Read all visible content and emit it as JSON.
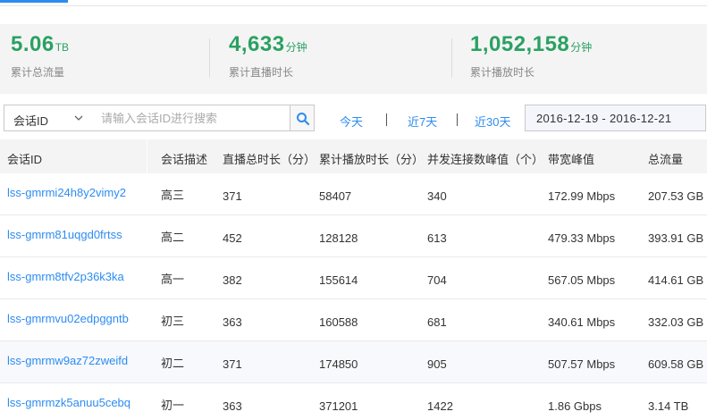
{
  "stats": [
    {
      "value": "5.06",
      "unit": "TB",
      "label": "累计总流量"
    },
    {
      "value": "4,633",
      "unit": "分钟",
      "label": "累计直播时长"
    },
    {
      "value": "1,052,158",
      "unit": "分钟",
      "label": "累计播放时长"
    }
  ],
  "filter": {
    "select_value": "会话ID",
    "search_placeholder": "请输入会话ID进行搜索",
    "quick_ranges": [
      "今天",
      "近7天",
      "近30天"
    ],
    "date_range": "2016-12-19 - 2016-12-21"
  },
  "table": {
    "headers": [
      "会话ID",
      "会话描述",
      "直播总时长（分）",
      "累计播放时长（分）",
      "并发连接数峰值（个）",
      "带宽峰值",
      "总流量"
    ],
    "rows": [
      [
        "lss-gmrmi24h8y2vimy2",
        "高三",
        "371",
        "58407",
        "340",
        "172.99 Mbps",
        "207.53 GB"
      ],
      [
        "lss-gmrm81uqgd0frtss",
        "高二",
        "452",
        "128128",
        "613",
        "479.33 Mbps",
        "393.91 GB"
      ],
      [
        "lss-gmrm8tfv2p36k3ka",
        "高一",
        "382",
        "155614",
        "704",
        "567.05 Mbps",
        "414.61 GB"
      ],
      [
        "lss-gmrmvu02edpggntb",
        "初三",
        "363",
        "160588",
        "681",
        "340.61 Mbps",
        "332.03 GB"
      ],
      [
        "lss-gmrmw9az72zweifd",
        "初二",
        "371",
        "174850",
        "905",
        "507.57 Mbps",
        "609.58 GB"
      ],
      [
        "lss-gmrmzk5anuu5cebq",
        "初一",
        "363",
        "371201",
        "1422",
        "1.86 Gbps",
        "3.14 TB"
      ]
    ]
  },
  "colors": {
    "accent": "#2d8cf0",
    "stat_green": "#2aa162",
    "panel_bg": "#f4f4f4"
  }
}
